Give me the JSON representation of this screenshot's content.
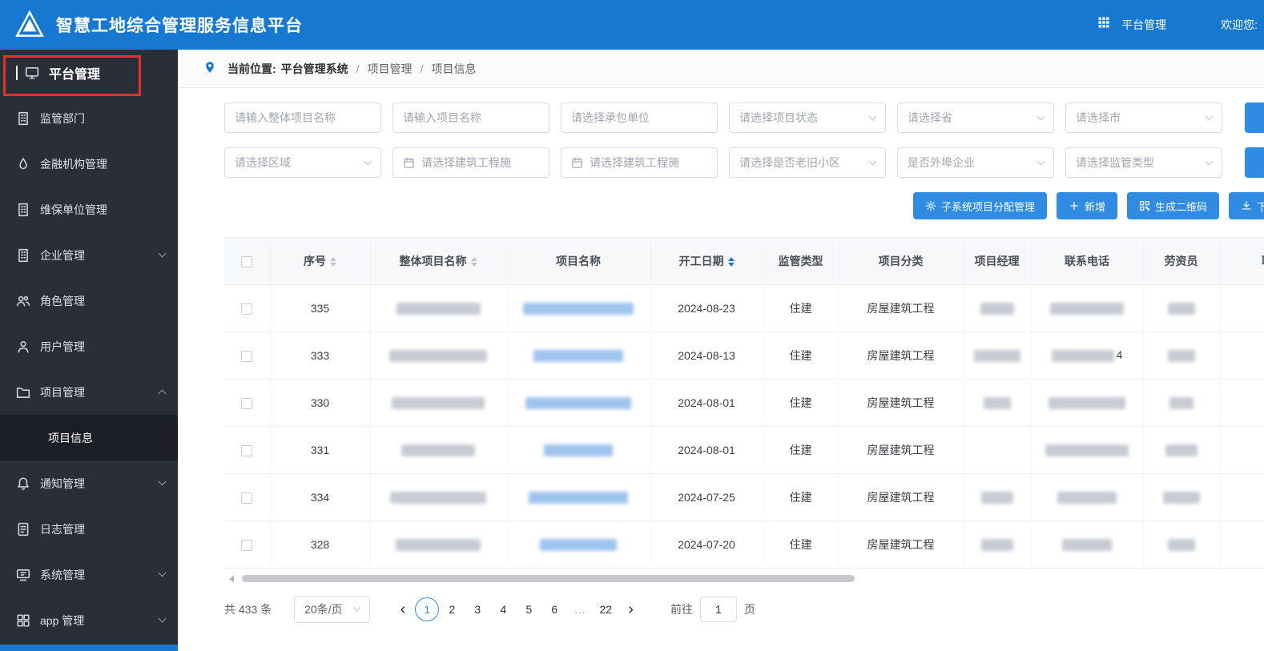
{
  "header": {
    "app_title": "智慧工地综合管理服务信息平台",
    "nav": {
      "platform_label": "平台管理"
    },
    "welcome_text": "欢迎您:"
  },
  "sidebar": {
    "items": [
      {
        "id": "platform",
        "label": "平台管理",
        "icon": "monitor-icon",
        "type": "header",
        "annotated": true
      },
      {
        "id": "regulator",
        "label": "监管部门",
        "icon": "building-icon"
      },
      {
        "id": "finance",
        "label": "金融机构管理",
        "icon": "bank-icon"
      },
      {
        "id": "maintenance",
        "label": "维保单位管理",
        "icon": "building-icon"
      },
      {
        "id": "enterprise",
        "label": "企业管理",
        "icon": "building-icon",
        "expandable": true,
        "expanded": false
      },
      {
        "id": "roles",
        "label": "角色管理",
        "icon": "users-icon"
      },
      {
        "id": "users",
        "label": "用户管理",
        "icon": "user-icon"
      },
      {
        "id": "projects",
        "label": "项目管理",
        "icon": "folder-icon",
        "expandable": true,
        "expanded": true
      },
      {
        "id": "project-info",
        "label": "项目信息",
        "child": true,
        "active": true
      },
      {
        "id": "notify",
        "label": "通知管理",
        "icon": "bell-icon",
        "expandable": true,
        "expanded": false
      },
      {
        "id": "logs",
        "label": "日志管理",
        "icon": "log-icon"
      },
      {
        "id": "system",
        "label": "系统管理",
        "icon": "system-icon",
        "expandable": true,
        "expanded": false
      },
      {
        "id": "app",
        "label": "app 管理",
        "icon": "grid-icon",
        "expandable": true,
        "expanded": false
      }
    ]
  },
  "breadcrumb": {
    "label": "当前位置:",
    "root": "平台管理系统",
    "separator": "/",
    "items": [
      "项目管理",
      "项目信息"
    ]
  },
  "filters": {
    "row1": [
      {
        "type": "text",
        "placeholder": "请输入整体项目名称"
      },
      {
        "type": "text",
        "placeholder": "请输入项目名称"
      },
      {
        "type": "text",
        "placeholder": "请选择承包单位"
      },
      {
        "type": "select",
        "placeholder": "请选择项目状态"
      },
      {
        "type": "select",
        "placeholder": "请选择省"
      },
      {
        "type": "select",
        "placeholder": "请选择市"
      }
    ],
    "row2": [
      {
        "type": "select",
        "placeholder": "请选择区域"
      },
      {
        "type": "date",
        "placeholder": "请选择建筑工程施"
      },
      {
        "type": "date",
        "placeholder": "请选择建筑工程施"
      },
      {
        "type": "select",
        "placeholder": "请选择是否老旧小区"
      },
      {
        "type": "select",
        "placeholder": "是否外埠企业"
      },
      {
        "type": "select",
        "placeholder": "请选择监管类型"
      }
    ]
  },
  "actions": [
    {
      "id": "assign",
      "label": "子系统项目分配管理",
      "icon": "gear-icon"
    },
    {
      "id": "add",
      "label": "新增",
      "icon": "plus-icon"
    },
    {
      "id": "generate-qrcode",
      "label": "生成二维码",
      "icon": "qrcode-icon"
    },
    {
      "id": "download",
      "label": "下载",
      "icon": "download-icon",
      "truncated": true
    }
  ],
  "table": {
    "columns": [
      {
        "type": "checkbox",
        "label": ""
      },
      {
        "label": "序号",
        "sortable": true
      },
      {
        "label": "整体项目名称",
        "sortable": true
      },
      {
        "label": "项目名称"
      },
      {
        "label": "开工日期",
        "sortable": true,
        "sort_active": true
      },
      {
        "label": "监管类型"
      },
      {
        "label": "项目分类"
      },
      {
        "label": "项目经理"
      },
      {
        "label": "联系电话"
      },
      {
        "label": "劳资员"
      },
      {
        "label": "联",
        "truncated": true
      }
    ],
    "rows": [
      {
        "seq": "335",
        "start_date": "2024-08-23",
        "regulator_type": "住建",
        "category": "房屋建筑工程",
        "overall_w": 105,
        "name_w": 138,
        "manager_w": 42,
        "phone_w": 92,
        "labor_w": 34
      },
      {
        "seq": "333",
        "start_date": "2024-08-13",
        "regulator_type": "住建",
        "category": "房屋建筑工程",
        "overall_w": 122,
        "name_w": 112,
        "manager_w": 58,
        "phone_w": 78,
        "phone_suffix": "4",
        "labor_w": 34
      },
      {
        "seq": "330",
        "start_date": "2024-08-01",
        "regulator_type": "住建",
        "category": "房屋建筑工程",
        "overall_w": 116,
        "name_w": 132,
        "manager_w": 34,
        "phone_w": 96,
        "labor_w": 30
      },
      {
        "seq": "331",
        "start_date": "2024-08-01",
        "regulator_type": "住建",
        "category": "房屋建筑工程",
        "overall_w": 92,
        "name_w": 86,
        "manager_w": 0,
        "phone_w": 104,
        "labor_w": 40
      },
      {
        "seq": "334",
        "start_date": "2024-07-25",
        "regulator_type": "住建",
        "category": "房屋建筑工程",
        "overall_w": 120,
        "name_w": 124,
        "manager_w": 40,
        "phone_w": 74,
        "labor_w": 46
      },
      {
        "seq": "328",
        "start_date": "2024-07-20",
        "regulator_type": "住建",
        "category": "房屋建筑工程",
        "overall_w": 106,
        "name_w": 96,
        "manager_w": 40,
        "phone_w": 62,
        "labor_w": 34
      }
    ]
  },
  "pagination": {
    "total_text": "共 433 条",
    "page_size": "20条/页",
    "pages": [
      "1",
      "2",
      "3",
      "4",
      "5",
      "6",
      "...",
      "22"
    ],
    "active_page": "1",
    "goto_label": "前往",
    "goto_value": "1",
    "goto_suffix": "页"
  },
  "colors": {
    "header_blue": "#1778d2",
    "primary_button": "#2f8ce2",
    "sidebar_bg": "#2a2f37",
    "annotation_red": "#e53030",
    "redacted_link_blue": "#9ec4ee"
  }
}
